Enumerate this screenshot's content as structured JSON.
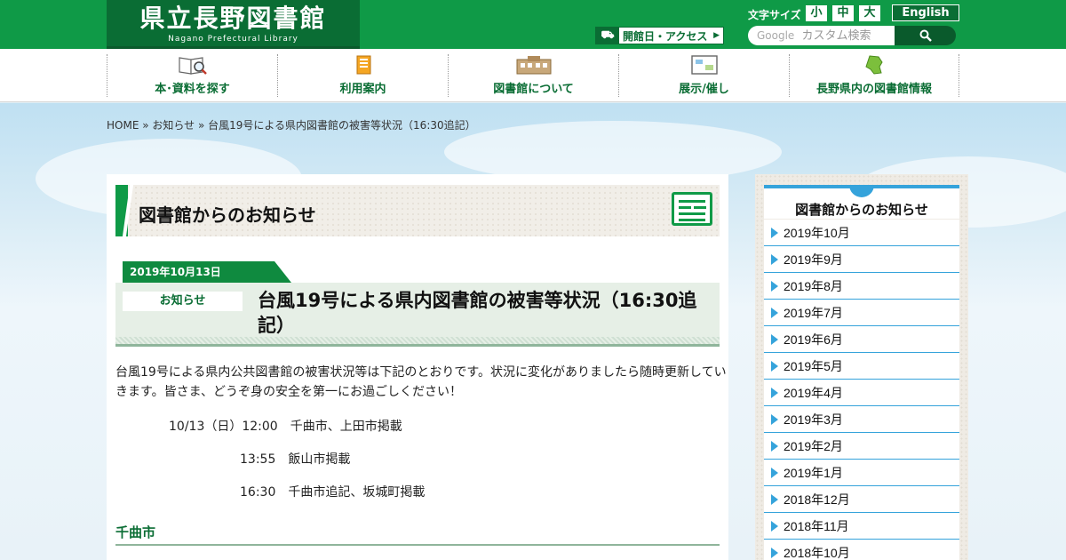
{
  "header": {
    "logo_title": "県立長野図書館",
    "logo_subtitle": "Nagano Prefectural Library",
    "access_label": "開館日・アクセス",
    "fontsize_label": "文字サイズ",
    "fontsize_small": "小",
    "fontsize_medium": "中",
    "fontsize_large": "大",
    "english_label": "English",
    "search_brand": "Google",
    "search_placeholder": "カスタム検索"
  },
  "nav": {
    "items": [
      {
        "label": "本･資料を探す",
        "icon": "book-search-icon"
      },
      {
        "label": "利用案内",
        "icon": "notebook-icon"
      },
      {
        "label": "図書館について",
        "icon": "building-icon"
      },
      {
        "label": "展示/催し",
        "icon": "board-icon"
      },
      {
        "label": "長野県内の図書館情報",
        "icon": "nagano-map-icon"
      }
    ]
  },
  "breadcrumb": {
    "home": "HOME",
    "sep1": " » ",
    "news": "お知らせ",
    "sep2": " » ",
    "current": "台風19号による県内図書館の被害等状況（16:30追記）"
  },
  "main": {
    "section_title": "図書館からのお知らせ",
    "date": "2019年10月13日",
    "badge": "お知らせ",
    "article_title": "台風19号による県内図書館の被害等状況（16:30追記）",
    "body": "台風19号による県内公共図書館の被害状況等は下記のとおりです。状況に変化がありましたら随時更新していきます。皆さま、どうぞ身の安全を第一にお過ごしください！",
    "updates": [
      "10/13（日）12:00　千曲市、上田市掲載",
      "13:55　飯山市掲載",
      "16:30　千曲市追記、坂城町掲載"
    ],
    "subhead": "千曲市"
  },
  "sidebar": {
    "title": "図書館からのお知らせ",
    "items": [
      "2019年10月",
      "2019年9月",
      "2019年8月",
      "2019年7月",
      "2019年6月",
      "2019年5月",
      "2019年4月",
      "2019年3月",
      "2019年2月",
      "2019年1月",
      "2018年12月",
      "2018年11月",
      "2018年10月"
    ]
  },
  "colors": {
    "brand_green": "#0f9a47",
    "dark_green": "#0a6d34",
    "accent_blue": "#35a3db"
  }
}
